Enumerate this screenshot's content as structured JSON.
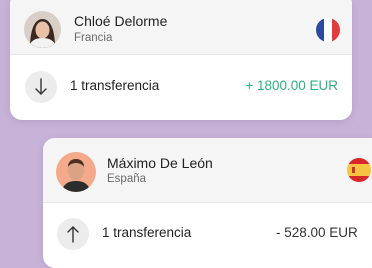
{
  "transfers": [
    {
      "name": "Chloé Delorme",
      "country": "Francia",
      "flag_icon": "france-flag-icon",
      "direction_icon": "arrow-down-icon",
      "count_label": "1 transferencia",
      "amount": "+ 1800.00 EUR",
      "amount_color": "#2fb07f"
    },
    {
      "name": "Máximo De León",
      "country": "España",
      "flag_icon": "spain-flag-icon",
      "direction_icon": "arrow-up-icon",
      "count_label": "1 transferencia",
      "amount": "- 528.00 EUR",
      "amount_color": "#333333"
    }
  ],
  "colors": {
    "background": "#c8b3d8",
    "positive": "#2fb07f"
  }
}
